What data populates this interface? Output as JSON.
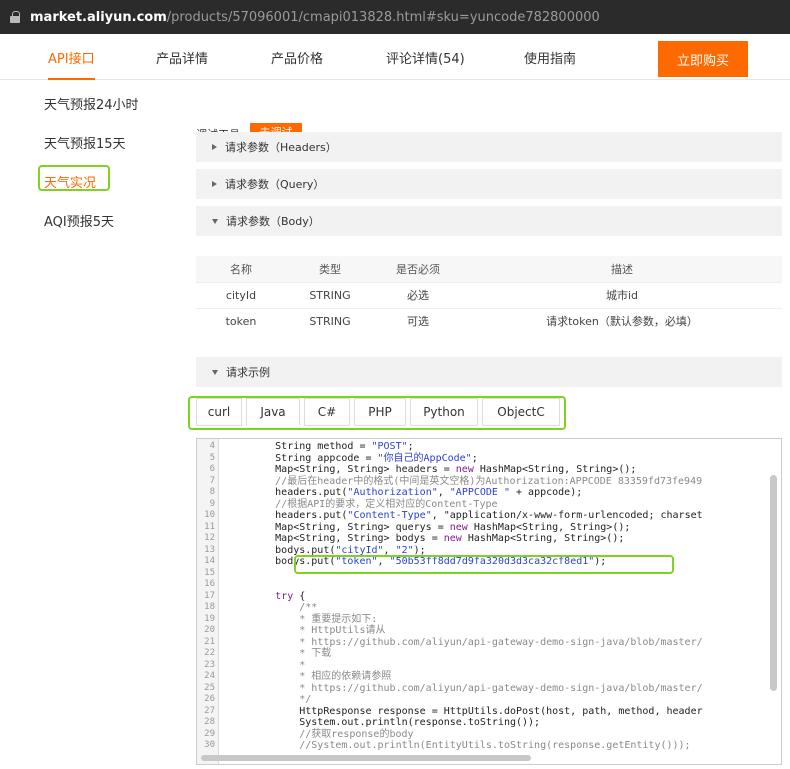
{
  "url": {
    "host": "market.aliyun.com",
    "path": "/products/57096001/cmapi013828.html#sku=yuncode782800000"
  },
  "tabs": [
    "API接口",
    "产品详情",
    "产品价格",
    "评论详情(54)",
    "使用指南"
  ],
  "buy_button": "立即购买",
  "sidebar": {
    "items": [
      "天气预报24小时",
      "天气预报15天",
      "天气实况",
      "AQI预报5天"
    ]
  },
  "debug_tool": {
    "label": "调试工具:",
    "button": "去调试"
  },
  "sections": {
    "headers": "请求参数（Headers）",
    "query": "请求参数（Query）",
    "body": "请求参数（Body）",
    "example": "请求示例"
  },
  "params_table": {
    "columns": [
      "名称",
      "类型",
      "是否必须",
      "描述"
    ],
    "rows": [
      [
        "cityId",
        "STRING",
        "必选",
        "城市id"
      ],
      [
        "token",
        "STRING",
        "可选",
        "请求token（默认参数，必填）"
      ]
    ]
  },
  "code_tabs": [
    "curl",
    "Java",
    "C#",
    "PHP",
    "Python",
    "ObjectC"
  ],
  "code_lines": [
    {
      "n": "4",
      "text": "        String method = \"POST\";"
    },
    {
      "n": "5",
      "text": "        String appcode = \"你自己的AppCode\";"
    },
    {
      "n": "6",
      "text": "        Map<String, String> headers = new HashMap<String, String>();"
    },
    {
      "n": "7",
      "text": "        //最后在header中的格式(中间是英文空格)为Authorization:APPCODE 83359fd73fe949"
    },
    {
      "n": "8",
      "text": "        headers.put(\"Authorization\", \"APPCODE \" + appcode);"
    },
    {
      "n": "9",
      "text": "        //根据API的要求，定义相对应的Content-Type"
    },
    {
      "n": "10",
      "text": "        headers.put(\"Content-Type\", \"application/x-www-form-urlencoded; charset"
    },
    {
      "n": "11",
      "text": "        Map<String, String> querys = new HashMap<String, String>();"
    },
    {
      "n": "12",
      "text": "        Map<String, String> bodys = new HashMap<String, String>();"
    },
    {
      "n": "13",
      "text": "        bodys.put(\"cityId\", \"2\");"
    },
    {
      "n": "14",
      "text": "        bodys.put(\"token\", \"50b53ff8dd7d9fa320d3d3ca32cf8ed1\");"
    },
    {
      "n": "15",
      "text": ""
    },
    {
      "n": "16",
      "text": ""
    },
    {
      "n": "17",
      "text": "        try {"
    },
    {
      "n": "18",
      "text": "            /**"
    },
    {
      "n": "19",
      "text": "            * 重要提示如下:"
    },
    {
      "n": "20",
      "text": "            * HttpUtils请从"
    },
    {
      "n": "21",
      "text": "            * https://github.com/aliyun/api-gateway-demo-sign-java/blob/master/"
    },
    {
      "n": "22",
      "text": "            * 下载"
    },
    {
      "n": "23",
      "text": "            *"
    },
    {
      "n": "24",
      "text": "            * 相应的依赖请参照"
    },
    {
      "n": "25",
      "text": "            * https://github.com/aliyun/api-gateway-demo-sign-java/blob/master/"
    },
    {
      "n": "26",
      "text": "            */"
    },
    {
      "n": "27",
      "text": "            HttpResponse response = HttpUtils.doPost(host, path, method, header"
    },
    {
      "n": "28",
      "text": "            System.out.println(response.toString());"
    },
    {
      "n": "29",
      "text": "            //获取response的body"
    },
    {
      "n": "30",
      "text": "            //System.out.println(EntityUtils.toString(response.getEntity()));"
    }
  ],
  "colors": {
    "accent": "#ff6a00",
    "highlight": "#7ed321",
    "string": "#2b3fd6",
    "keyword": "#7a1f8a",
    "comment": "#8a8a8a"
  }
}
